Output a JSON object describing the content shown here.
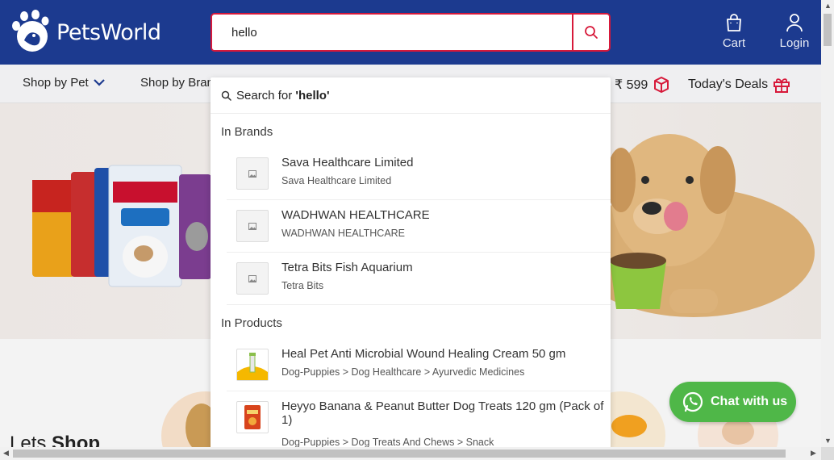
{
  "header": {
    "logo_text": "PetsWorld",
    "search_value": "hello",
    "cart_label": "Cart",
    "login_label": "Login"
  },
  "nav": {
    "shop_by_pet": "Shop by Pet",
    "shop_by_brand": "Shop by Bran",
    "offer_text": "₹ 599",
    "todays_deals": "Today's Deals"
  },
  "dropdown": {
    "search_for_prefix": "Search for ",
    "search_for_query": "'hello'",
    "brands_heading": "In Brands",
    "brands": [
      {
        "title": "Sava Healthcare Limited",
        "sub": "Sava Healthcare Limited"
      },
      {
        "title": "WADHWAN HEALTHCARE",
        "sub": "WADHWAN HEALTHCARE"
      },
      {
        "title": "Tetra Bits Fish Aquarium",
        "sub": "Tetra Bits"
      }
    ],
    "products_heading": "In Products",
    "products": [
      {
        "title": "Heal Pet Anti Microbial Wound Healing Cream 50 gm",
        "sub": "Dog-Puppies > Dog Healthcare > Ayurvedic Medicines"
      },
      {
        "title": "Heyyo Banana & Peanut Butter Dog Treats 120 gm (Pack of 1)",
        "sub": "Dog-Puppies > Dog Treats And Chews > Snack"
      }
    ]
  },
  "page": {
    "lets": "Lets ",
    "shop": "Shop"
  },
  "whatsapp": {
    "label": "Chat with us"
  },
  "colors": {
    "header_bg": "#1c3a8f",
    "accent_red": "#d7193a",
    "whatsapp_green": "#4fb748"
  }
}
